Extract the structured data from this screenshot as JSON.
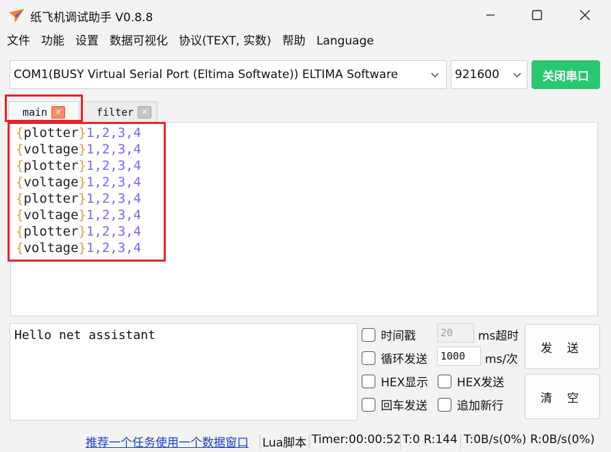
{
  "window": {
    "title": "纸飞机调试助手 V0.8.8"
  },
  "menu": [
    "文件",
    "功能",
    "设置",
    "数据可视化",
    "协议(TEXT, 实数)",
    "帮助",
    "Language"
  ],
  "port": {
    "selected": "COM1(BUSY  Virtual Serial Port (Eltima Softwate)) ELTIMA Software",
    "baud": "921600",
    "toggle_label": "关闭串口"
  },
  "tabs": [
    {
      "label": "main"
    },
    {
      "label": "filter"
    }
  ],
  "log": {
    "lines": [
      {
        "open": "{",
        "tag": "plotter",
        "close": "}",
        "values": "1,2,3,4"
      },
      {
        "open": "{",
        "tag": "voltage",
        "close": "}",
        "values": "1,2,3,4"
      },
      {
        "open": "{",
        "tag": "plotter",
        "close": "}",
        "values": "1,2,3,4"
      },
      {
        "open": "{",
        "tag": "voltage",
        "close": "}",
        "values": "1,2,3,4"
      },
      {
        "open": "{",
        "tag": "plotter",
        "close": "}",
        "values": "1,2,3,4"
      },
      {
        "open": "{",
        "tag": "voltage",
        "close": "}",
        "values": "1,2,3,4"
      },
      {
        "open": "{",
        "tag": "plotter",
        "close": "}",
        "values": "1,2,3,4"
      },
      {
        "open": "{",
        "tag": "voltage",
        "close": "}",
        "values": "1,2,3,4"
      }
    ]
  },
  "send": {
    "text": "Hello net assistant",
    "timestamp_label": "时间戳",
    "timeout_value": "20",
    "timeout_unit": "ms超时",
    "loop_label": "循环发送",
    "loop_value": "1000",
    "loop_unit": "ms/次",
    "hex_display_label": "HEX显示",
    "hex_send_label": "HEX发送",
    "crlf_label": "回车发送",
    "newline_label": "追加新行",
    "send_button": "发 送",
    "clear_button": "清 空"
  },
  "status": {
    "recommend_link": "推荐一个任务使用一个数据窗口",
    "lua": "Lua脚本",
    "timer": "Timer:00:00:52",
    "tx_rx": "T:0 R:144",
    "rate": "T:0B/s(0%) R:0B/s(0%)"
  },
  "colors": {
    "accent_green": "#27c870",
    "highlight_red": "#e8202a",
    "brace_orange": "#e69a3a",
    "number_purple": "#7c66dd",
    "link_blue": "#1a3ecc"
  }
}
